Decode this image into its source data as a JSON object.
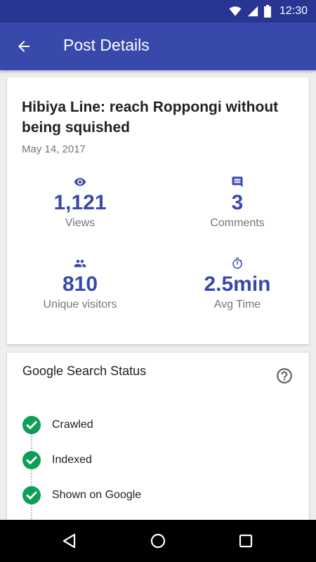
{
  "status_bar": {
    "time": "12:30",
    "icons": [
      "wifi-icon",
      "signal-icon",
      "battery-icon"
    ]
  },
  "app_bar": {
    "title": "Post Details",
    "back_icon": "arrow-back-icon"
  },
  "post": {
    "title": "Hibiya Line: reach Roppongi without being squished",
    "date": "May 14, 2017"
  },
  "stats": [
    {
      "icon": "eye-icon",
      "value": "1,121",
      "label": "Views"
    },
    {
      "icon": "comment-icon",
      "value": "3",
      "label": "Comments"
    },
    {
      "icon": "people-icon",
      "value": "810",
      "label": "Unique visitors"
    },
    {
      "icon": "timer-icon",
      "value": "2.5min",
      "label": "Avg Time"
    }
  ],
  "search_status": {
    "title": "Google Search Status",
    "help_icon": "help-icon",
    "items": [
      {
        "label": "Crawled",
        "status": "done"
      },
      {
        "label": "Indexed",
        "status": "done"
      },
      {
        "label": "Shown on Google",
        "status": "done"
      }
    ]
  },
  "nav_bar": {
    "buttons": [
      "nav-back-icon",
      "nav-home-icon",
      "nav-recents-icon"
    ]
  },
  "colors": {
    "primary": "#3949ab",
    "primary_dark": "#283593",
    "success": "#0f9d58",
    "text_primary": "#212121",
    "text_secondary": "#757575"
  }
}
